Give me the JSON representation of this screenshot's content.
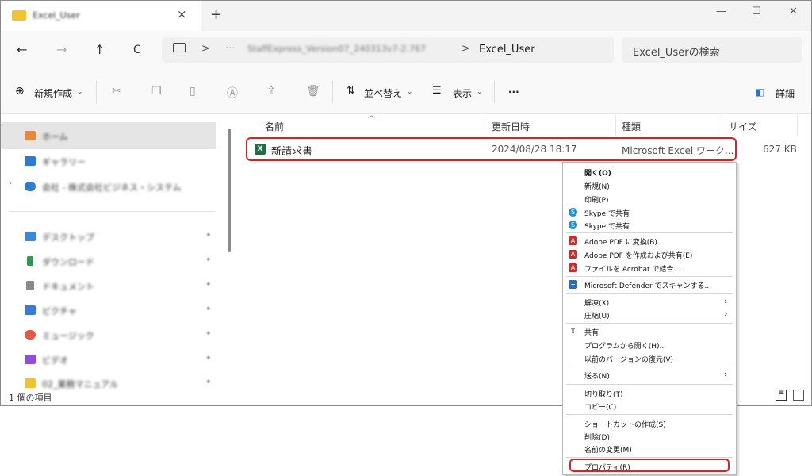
{
  "tab": {
    "title": "Excel_User",
    "close": "×",
    "new_tab": "+"
  },
  "window_controls": {
    "minimize": "—",
    "maximize": "☐",
    "close": "✕"
  },
  "nav": {
    "back": "←",
    "forward": "→",
    "up": "↑",
    "refresh": "C"
  },
  "address": {
    "ellipsis": "···",
    "path_blurred": "StaffExpress_Version07_240313v7-2.767",
    "current": "Excel_User",
    "chevron": ">"
  },
  "search": {
    "placeholder": "Excel_Userの検索"
  },
  "toolbar": {
    "new": "新規作成",
    "sort": "並べ替え",
    "view": "表示",
    "more": "···",
    "details": "詳細"
  },
  "sidebar": {
    "items": [
      {
        "label": "ホーム",
        "color": "#e8883a"
      },
      {
        "label": "ギャラリー",
        "color": "#2e7bd6"
      },
      {
        "label": "会社 - 株式会社ビジネス・システム",
        "color": "#2e7bd6"
      },
      {
        "label": "デスクトップ",
        "color": "#3b87d8"
      },
      {
        "label": "ダウンロード",
        "color": "#2c9b4f"
      },
      {
        "label": "ドキュメント",
        "color": "#8a8a8a"
      },
      {
        "label": "ピクチャ",
        "color": "#3b7bd8"
      },
      {
        "label": "ミュージック",
        "color": "#e25a48"
      },
      {
        "label": "ビデオ",
        "color": "#8f4fd8"
      },
      {
        "label": "02_業務マニュアル",
        "color": "#f1c232"
      }
    ]
  },
  "columns": {
    "name": "名前",
    "date": "更新日時",
    "type": "種類",
    "size": "サイズ"
  },
  "file": {
    "icon_label": "X",
    "name": "新請求書",
    "date": "2024/08/28 18:17",
    "type": "Microsoft Excel ワーク...",
    "size": "627 KB"
  },
  "status": {
    "count": "1 個の項目"
  },
  "context_menu": {
    "open": "開く(O)",
    "new": "新規(N)",
    "print": "印刷(P)",
    "skype1": "Skype で共有",
    "skype2": "Skype で共有",
    "pdf_convert": "Adobe PDF に変換(B)",
    "pdf_share": "Adobe PDF を作成および共有(E)",
    "acrobat": "ファイルを Acrobat で結合...",
    "defender": "Microsoft Defender でスキャンする...",
    "extract": "解凍(X)",
    "compress": "圧縮(U)",
    "share": "共有",
    "open_with": "プログラムから開く(H)...",
    "restore": "以前のバージョンの復元(V)",
    "send_to": "送る(N)",
    "cut": "切り取り(T)",
    "copy": "コピー(C)",
    "shortcut": "ショートカットの作成(S)",
    "delete": "削除(D)",
    "rename": "名前の変更(M)",
    "properties": "プロパティ(R)"
  }
}
